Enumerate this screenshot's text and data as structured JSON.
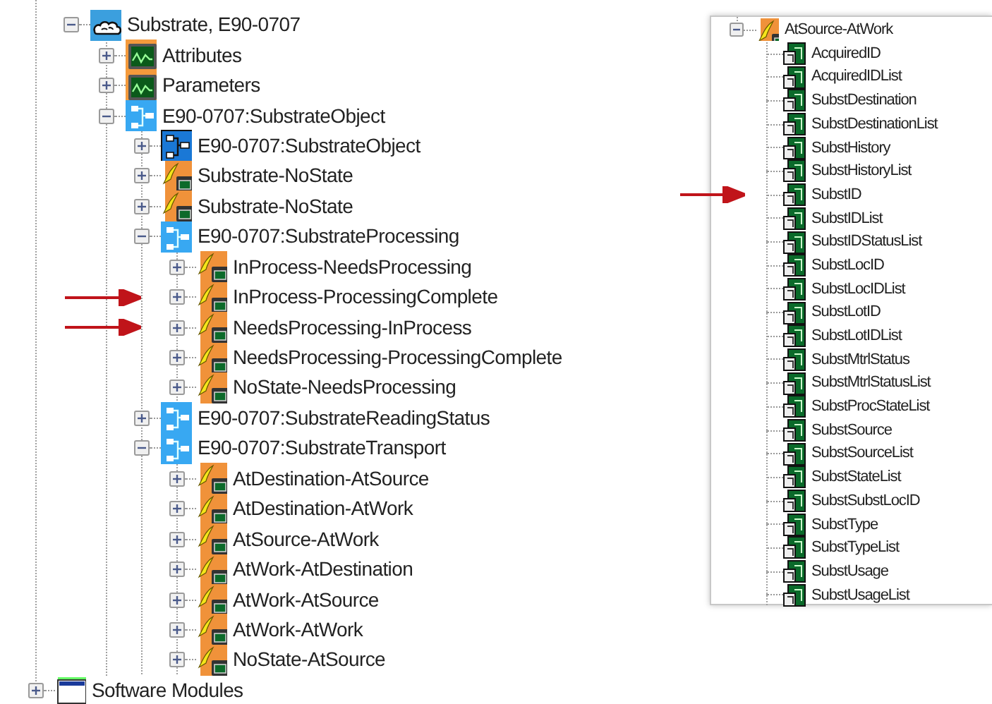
{
  "main_tree": {
    "branch": {
      "label": "Substrate, E90-0707",
      "kind": "cloud",
      "expanded": true,
      "children": [
        {
          "label": "Attributes",
          "kind": "chart",
          "expanded": false
        },
        {
          "label": "Parameters",
          "kind": "chart",
          "expanded": false
        },
        {
          "label": "E90-0707:SubstrateObject",
          "kind": "diagram",
          "expanded": true,
          "children": [
            {
              "label": "E90-0707:SubstrateObject",
              "kind": "object",
              "expanded": false
            },
            {
              "label": "Substrate-NoState",
              "kind": "transition",
              "expanded": false
            },
            {
              "label": "Substrate-NoState",
              "kind": "transition",
              "expanded": false
            },
            {
              "label": "E90-0707:SubstrateProcessing",
              "kind": "diagram",
              "expanded": true,
              "children": [
                {
                  "label": "InProcess-NeedsProcessing",
                  "kind": "transition",
                  "expanded": false,
                  "arrow": false
                },
                {
                  "label": "InProcess-ProcessingComplete",
                  "kind": "transition",
                  "expanded": false,
                  "arrow": true
                },
                {
                  "label": "NeedsProcessing-InProcess",
                  "kind": "transition",
                  "expanded": false,
                  "arrow": true
                },
                {
                  "label": "NeedsProcessing-ProcessingComplete",
                  "kind": "transition",
                  "expanded": false,
                  "arrow": false
                },
                {
                  "label": "NoState-NeedsProcessing",
                  "kind": "transition",
                  "expanded": false,
                  "arrow": false
                }
              ]
            },
            {
              "label": "E90-0707:SubstrateReadingStatus",
              "kind": "diagram",
              "expanded": false
            },
            {
              "label": "E90-0707:SubstrateTransport",
              "kind": "diagram",
              "expanded": true,
              "children": [
                {
                  "label": "AtDestination-AtSource",
                  "kind": "transition",
                  "expanded": false
                },
                {
                  "label": "AtDestination-AtWork",
                  "kind": "transition",
                  "expanded": false
                },
                {
                  "label": "AtSource-AtWork",
                  "kind": "transition",
                  "expanded": false
                },
                {
                  "label": "AtWork-AtDestination",
                  "kind": "transition",
                  "expanded": false
                },
                {
                  "label": "AtWork-AtSource",
                  "kind": "transition",
                  "expanded": false
                },
                {
                  "label": "AtWork-AtWork",
                  "kind": "transition",
                  "expanded": false
                },
                {
                  "label": "NoState-AtSource",
                  "kind": "transition",
                  "expanded": false
                }
              ]
            }
          ]
        }
      ]
    },
    "next_items": [
      {
        "label": "Software Modules",
        "kind": "module",
        "expanded": false
      }
    ]
  },
  "detail_tree": {
    "label": "AtSource-AtWork",
    "kind": "transition",
    "expanded": true,
    "children": [
      {
        "label": "AcquiredID",
        "kind": "variable",
        "arrow": false
      },
      {
        "label": "AcquiredIDList",
        "kind": "variable",
        "arrow": false
      },
      {
        "label": "SubstDestination",
        "kind": "variable",
        "arrow": false
      },
      {
        "label": "SubstDestinationList",
        "kind": "variable",
        "arrow": false
      },
      {
        "label": "SubstHistory",
        "kind": "variable",
        "arrow": false
      },
      {
        "label": "SubstHistoryList",
        "kind": "variable",
        "arrow": false
      },
      {
        "label": "SubstID",
        "kind": "variable",
        "arrow": true
      },
      {
        "label": "SubstIDList",
        "kind": "variable",
        "arrow": false
      },
      {
        "label": "SubstIDStatusList",
        "kind": "variable",
        "arrow": false
      },
      {
        "label": "SubstLocID",
        "kind": "variable",
        "arrow": false
      },
      {
        "label": "SubstLocIDList",
        "kind": "variable",
        "arrow": false
      },
      {
        "label": "SubstLotID",
        "kind": "variable",
        "arrow": false
      },
      {
        "label": "SubstLotIDList",
        "kind": "variable",
        "arrow": false
      },
      {
        "label": "SubstMtrlStatus",
        "kind": "variable",
        "arrow": false
      },
      {
        "label": "SubstMtrlStatusList",
        "kind": "variable",
        "arrow": false
      },
      {
        "label": "SubstProcStateList",
        "kind": "variable",
        "arrow": false
      },
      {
        "label": "SubstSource",
        "kind": "variable",
        "arrow": false
      },
      {
        "label": "SubstSourceList",
        "kind": "variable",
        "arrow": false
      },
      {
        "label": "SubstStateList",
        "kind": "variable",
        "arrow": false
      },
      {
        "label": "SubstSubstLocID",
        "kind": "variable",
        "arrow": false
      },
      {
        "label": "SubstType",
        "kind": "variable",
        "arrow": false
      },
      {
        "label": "SubstTypeList",
        "kind": "variable",
        "arrow": false
      },
      {
        "label": "SubstUsage",
        "kind": "variable",
        "arrow": false
      },
      {
        "label": "SubstUsageList",
        "kind": "variable",
        "arrow": false
      }
    ]
  }
}
